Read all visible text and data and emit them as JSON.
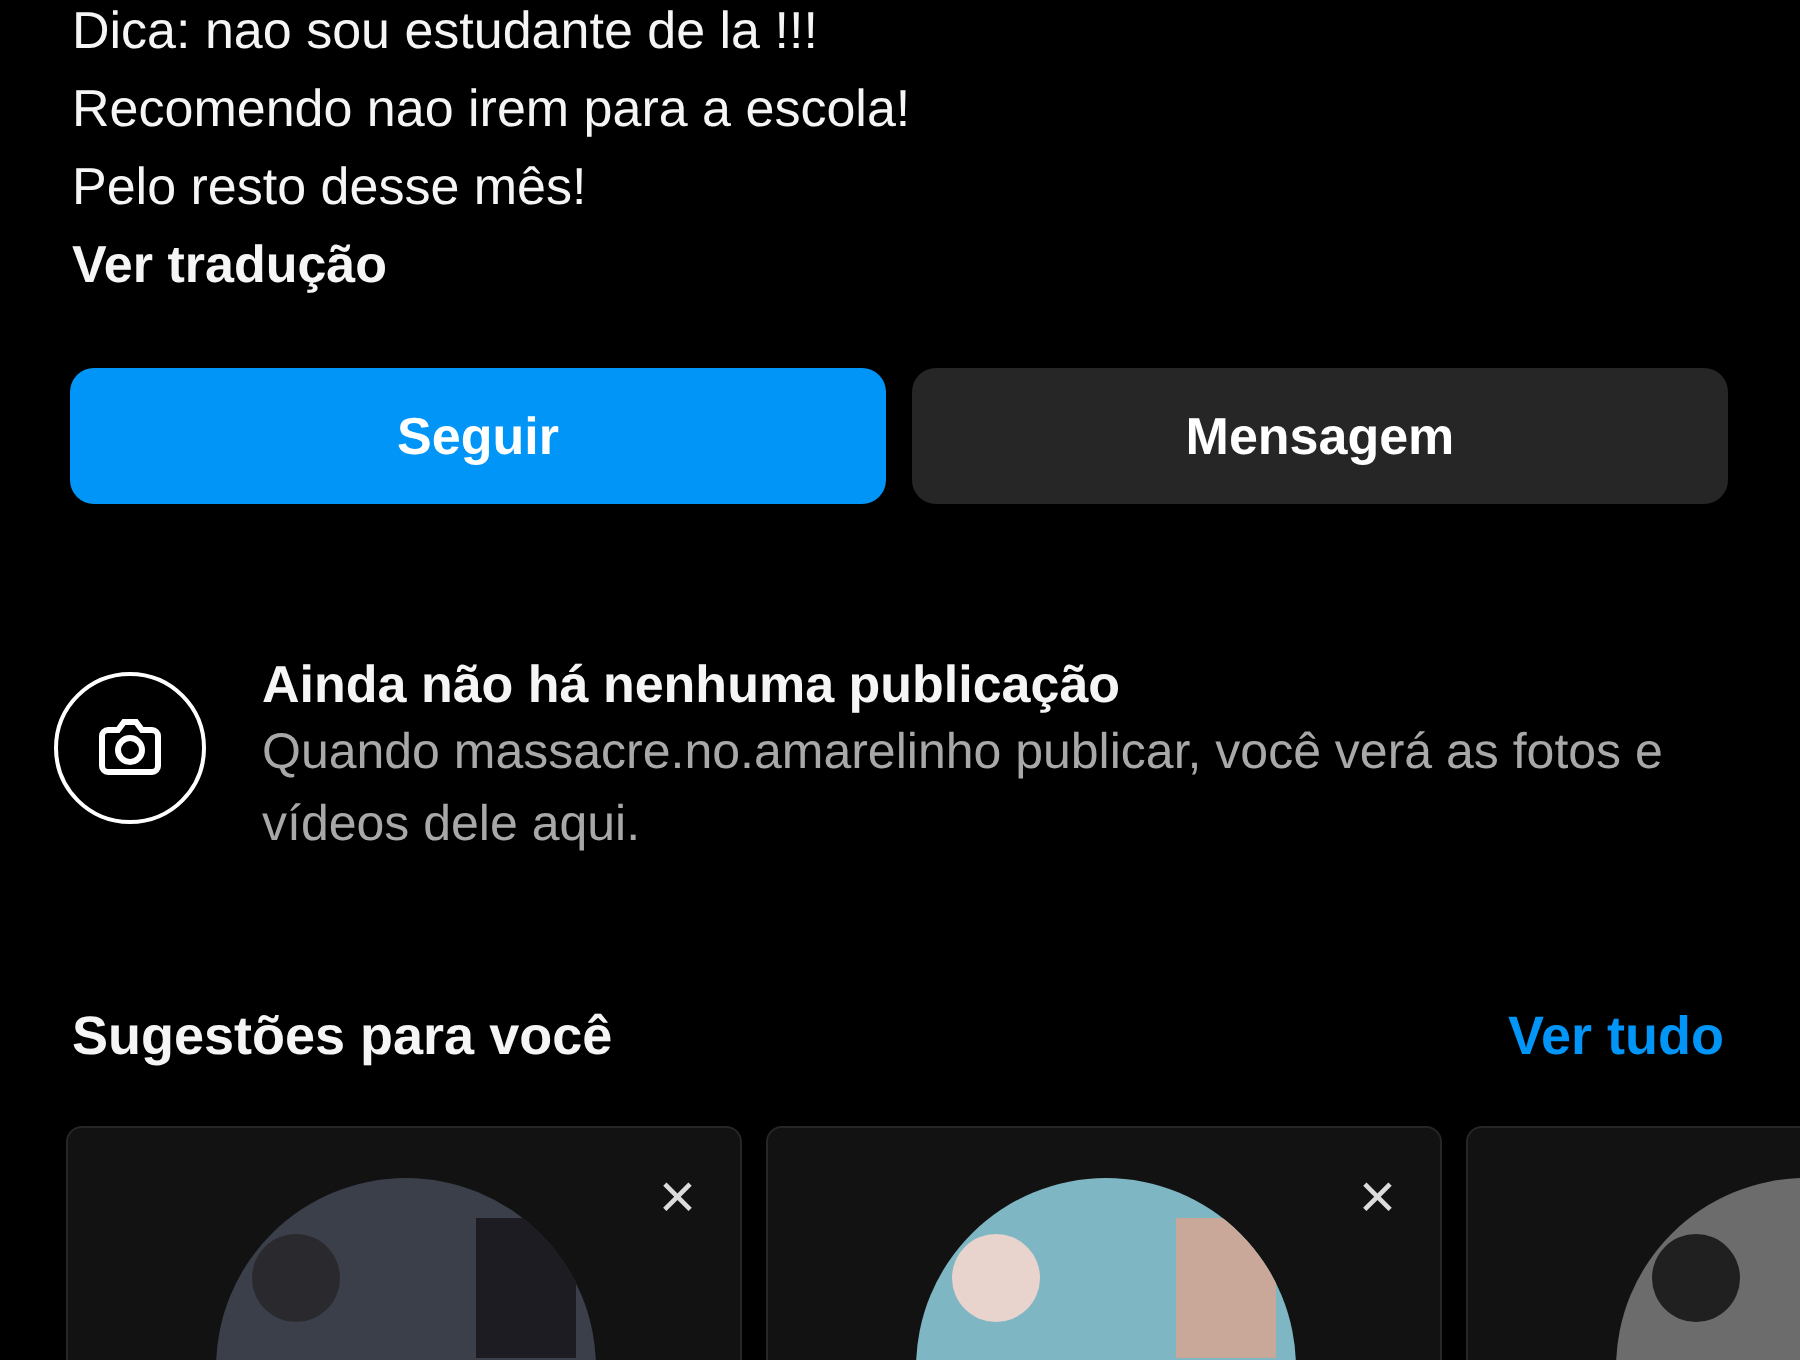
{
  "bio": [
    "Dica: nao sou estudante de la !!!",
    "Recomendo nao irem para a escola!",
    "Pelo resto desse mês!"
  ],
  "translate_link": "Ver tradução",
  "buttons": [
    {
      "label": "Seguir",
      "kind": "primary"
    },
    {
      "label": "Mensagem",
      "kind": "secondary"
    }
  ],
  "empty_state": {
    "title": "Ainda não há nenhuma publicação",
    "text": "Quando massacre.no.amarelinho publicar, você verá as fotos e vídeos dele aqui."
  },
  "suggestions": {
    "title": "Sugestões para você",
    "see_all": "Ver tudo",
    "cards": [
      {
        "close": "×",
        "avatar": {
          "kind": "picture"
        }
      },
      {
        "close": "×",
        "avatar": {
          "kind": "picture"
        }
      },
      {
        "avatar": {
          "kind": "picture"
        }
      }
    ]
  }
}
